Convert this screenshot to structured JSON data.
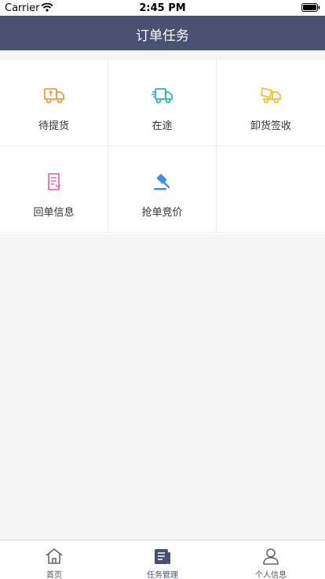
{
  "status_bar": {
    "carrier": "Carrier",
    "time": "2:45 PM"
  },
  "nav": {
    "title": "订单任务"
  },
  "grid": {
    "items": [
      {
        "label": "待提货",
        "icon": "truck-loading-icon",
        "color": "#f59a3c"
      },
      {
        "label": "在途",
        "icon": "truck-moving-icon",
        "color": "#27b9b0"
      },
      {
        "label": "卸货签收",
        "icon": "truck-unloading-icon",
        "color": "#f5c02c"
      },
      {
        "label": "回单信息",
        "icon": "receipt-icon",
        "color": "#e86fc5"
      },
      {
        "label": "抢单竞价",
        "icon": "auction-gavel-icon",
        "color": "#3a8ef0"
      }
    ]
  },
  "tabs": [
    {
      "label": "首页",
      "icon": "home-icon",
      "active": false
    },
    {
      "label": "任务管理",
      "icon": "task-icon",
      "active": true
    },
    {
      "label": "个人信息",
      "icon": "user-icon",
      "active": false
    }
  ],
  "colors": {
    "nav_bg": "#4a5170",
    "page_bg": "#f5f5f6"
  }
}
